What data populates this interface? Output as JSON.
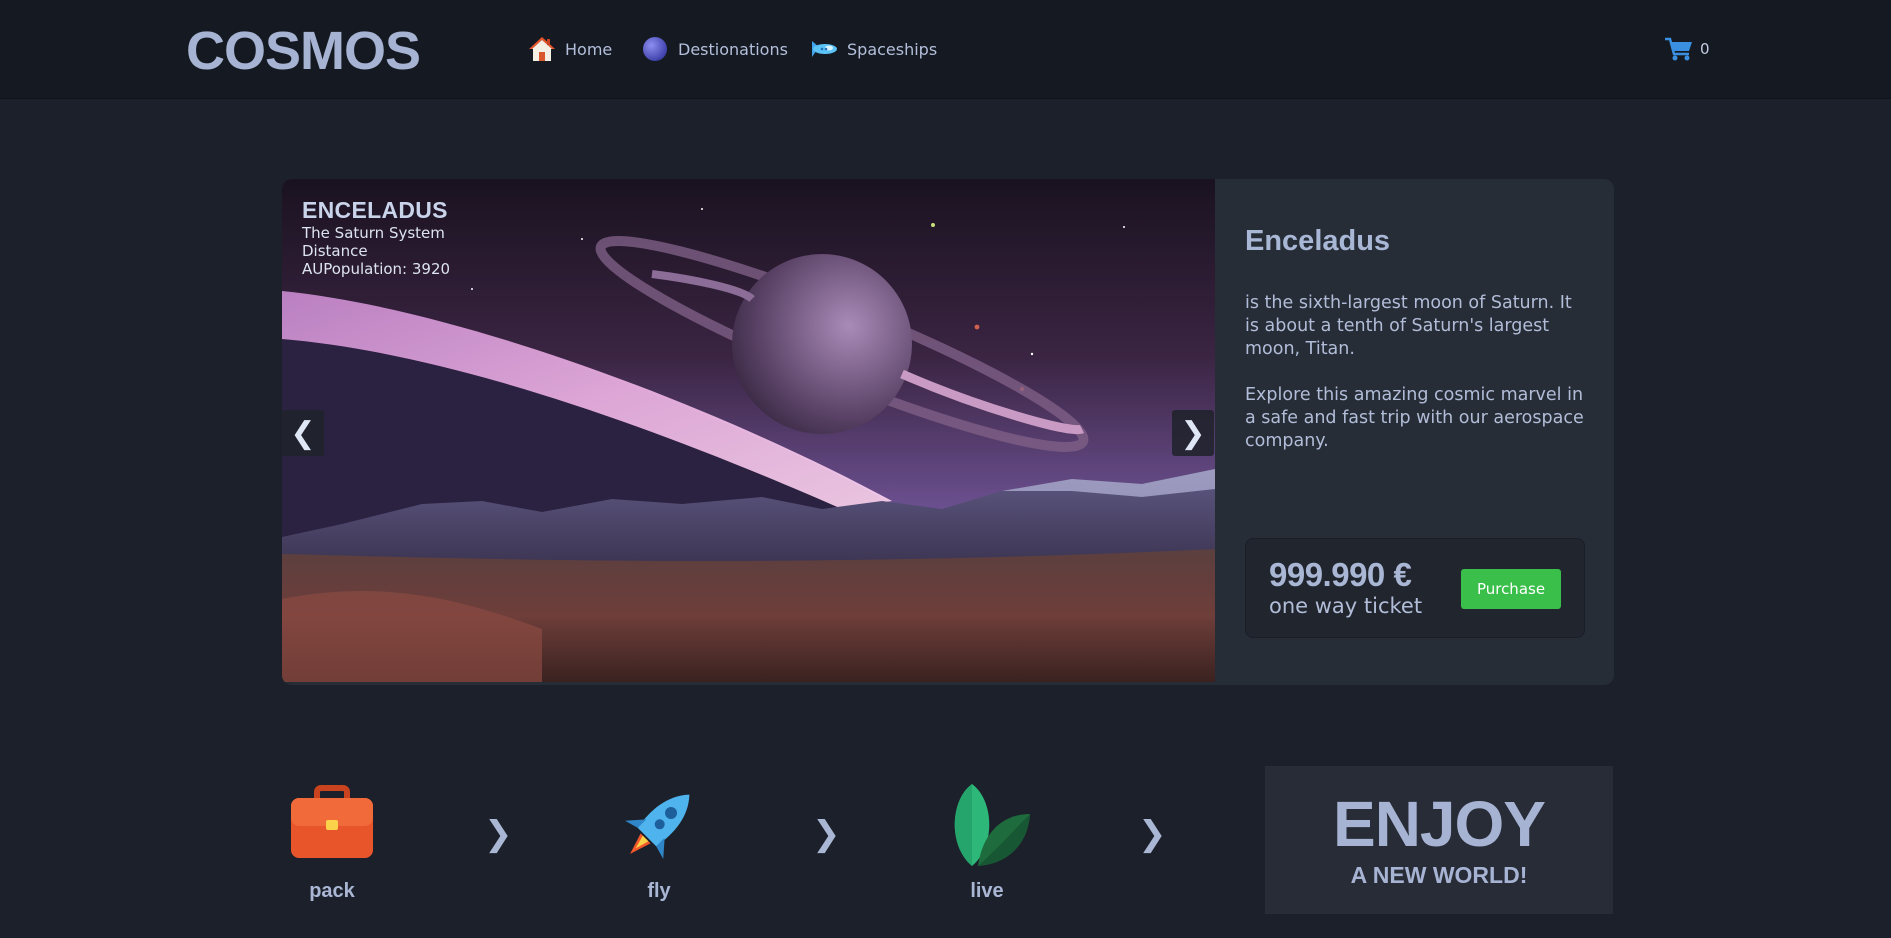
{
  "header": {
    "logo": "COSMOS",
    "nav": [
      {
        "label": "Home",
        "icon": "home-icon"
      },
      {
        "label": "Destionations",
        "icon": "planet-icon"
      },
      {
        "label": "Spaceships",
        "icon": "spaceship-icon"
      }
    ],
    "cart": {
      "icon": "cart-icon",
      "count": "0"
    }
  },
  "slider": {
    "caption": {
      "title": "ENCELADUS",
      "lines": [
        "The Saturn System",
        "Distance",
        "AUPopulation: 3920"
      ]
    },
    "prev_label": "❮",
    "next_label": "❯"
  },
  "info": {
    "title": "Enceladus",
    "paragraphs": [
      "is the sixth-largest moon of Saturn. It is about a tenth of Saturn's largest moon, Titan.",
      "Explore this amazing cosmic marvel in a safe and fast trip with our aerospace company."
    ],
    "price": "999.990 €",
    "price_note": "one way ticket",
    "purchase_label": "Purchase",
    "purchase_color": "#3bbf4b"
  },
  "steps": [
    {
      "label": "pack",
      "icon": "briefcase-icon"
    },
    {
      "label": "fly",
      "icon": "rocket-icon"
    },
    {
      "label": "live",
      "icon": "leaf-icon"
    }
  ],
  "step_chevron": "❯",
  "enjoy": {
    "big": "ENJOY",
    "small": "A NEW WORLD!"
  }
}
